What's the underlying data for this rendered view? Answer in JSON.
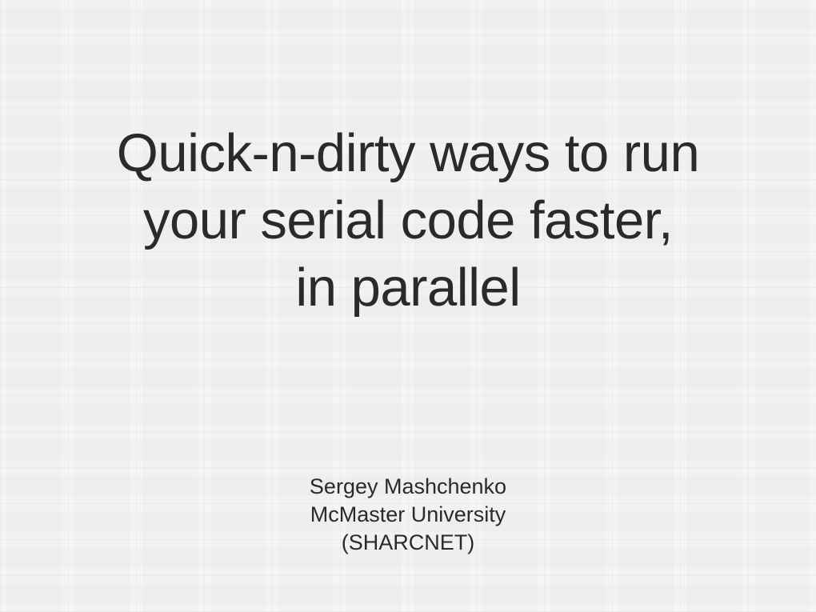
{
  "slide": {
    "title_line1": "Quick-n-dirty ways to run",
    "title_line2": "your serial code faster,",
    "title_line3": "in parallel",
    "author_name": "Sergey Mashchenko",
    "affiliation": "McMaster University",
    "org": "(SHARCNET)"
  }
}
